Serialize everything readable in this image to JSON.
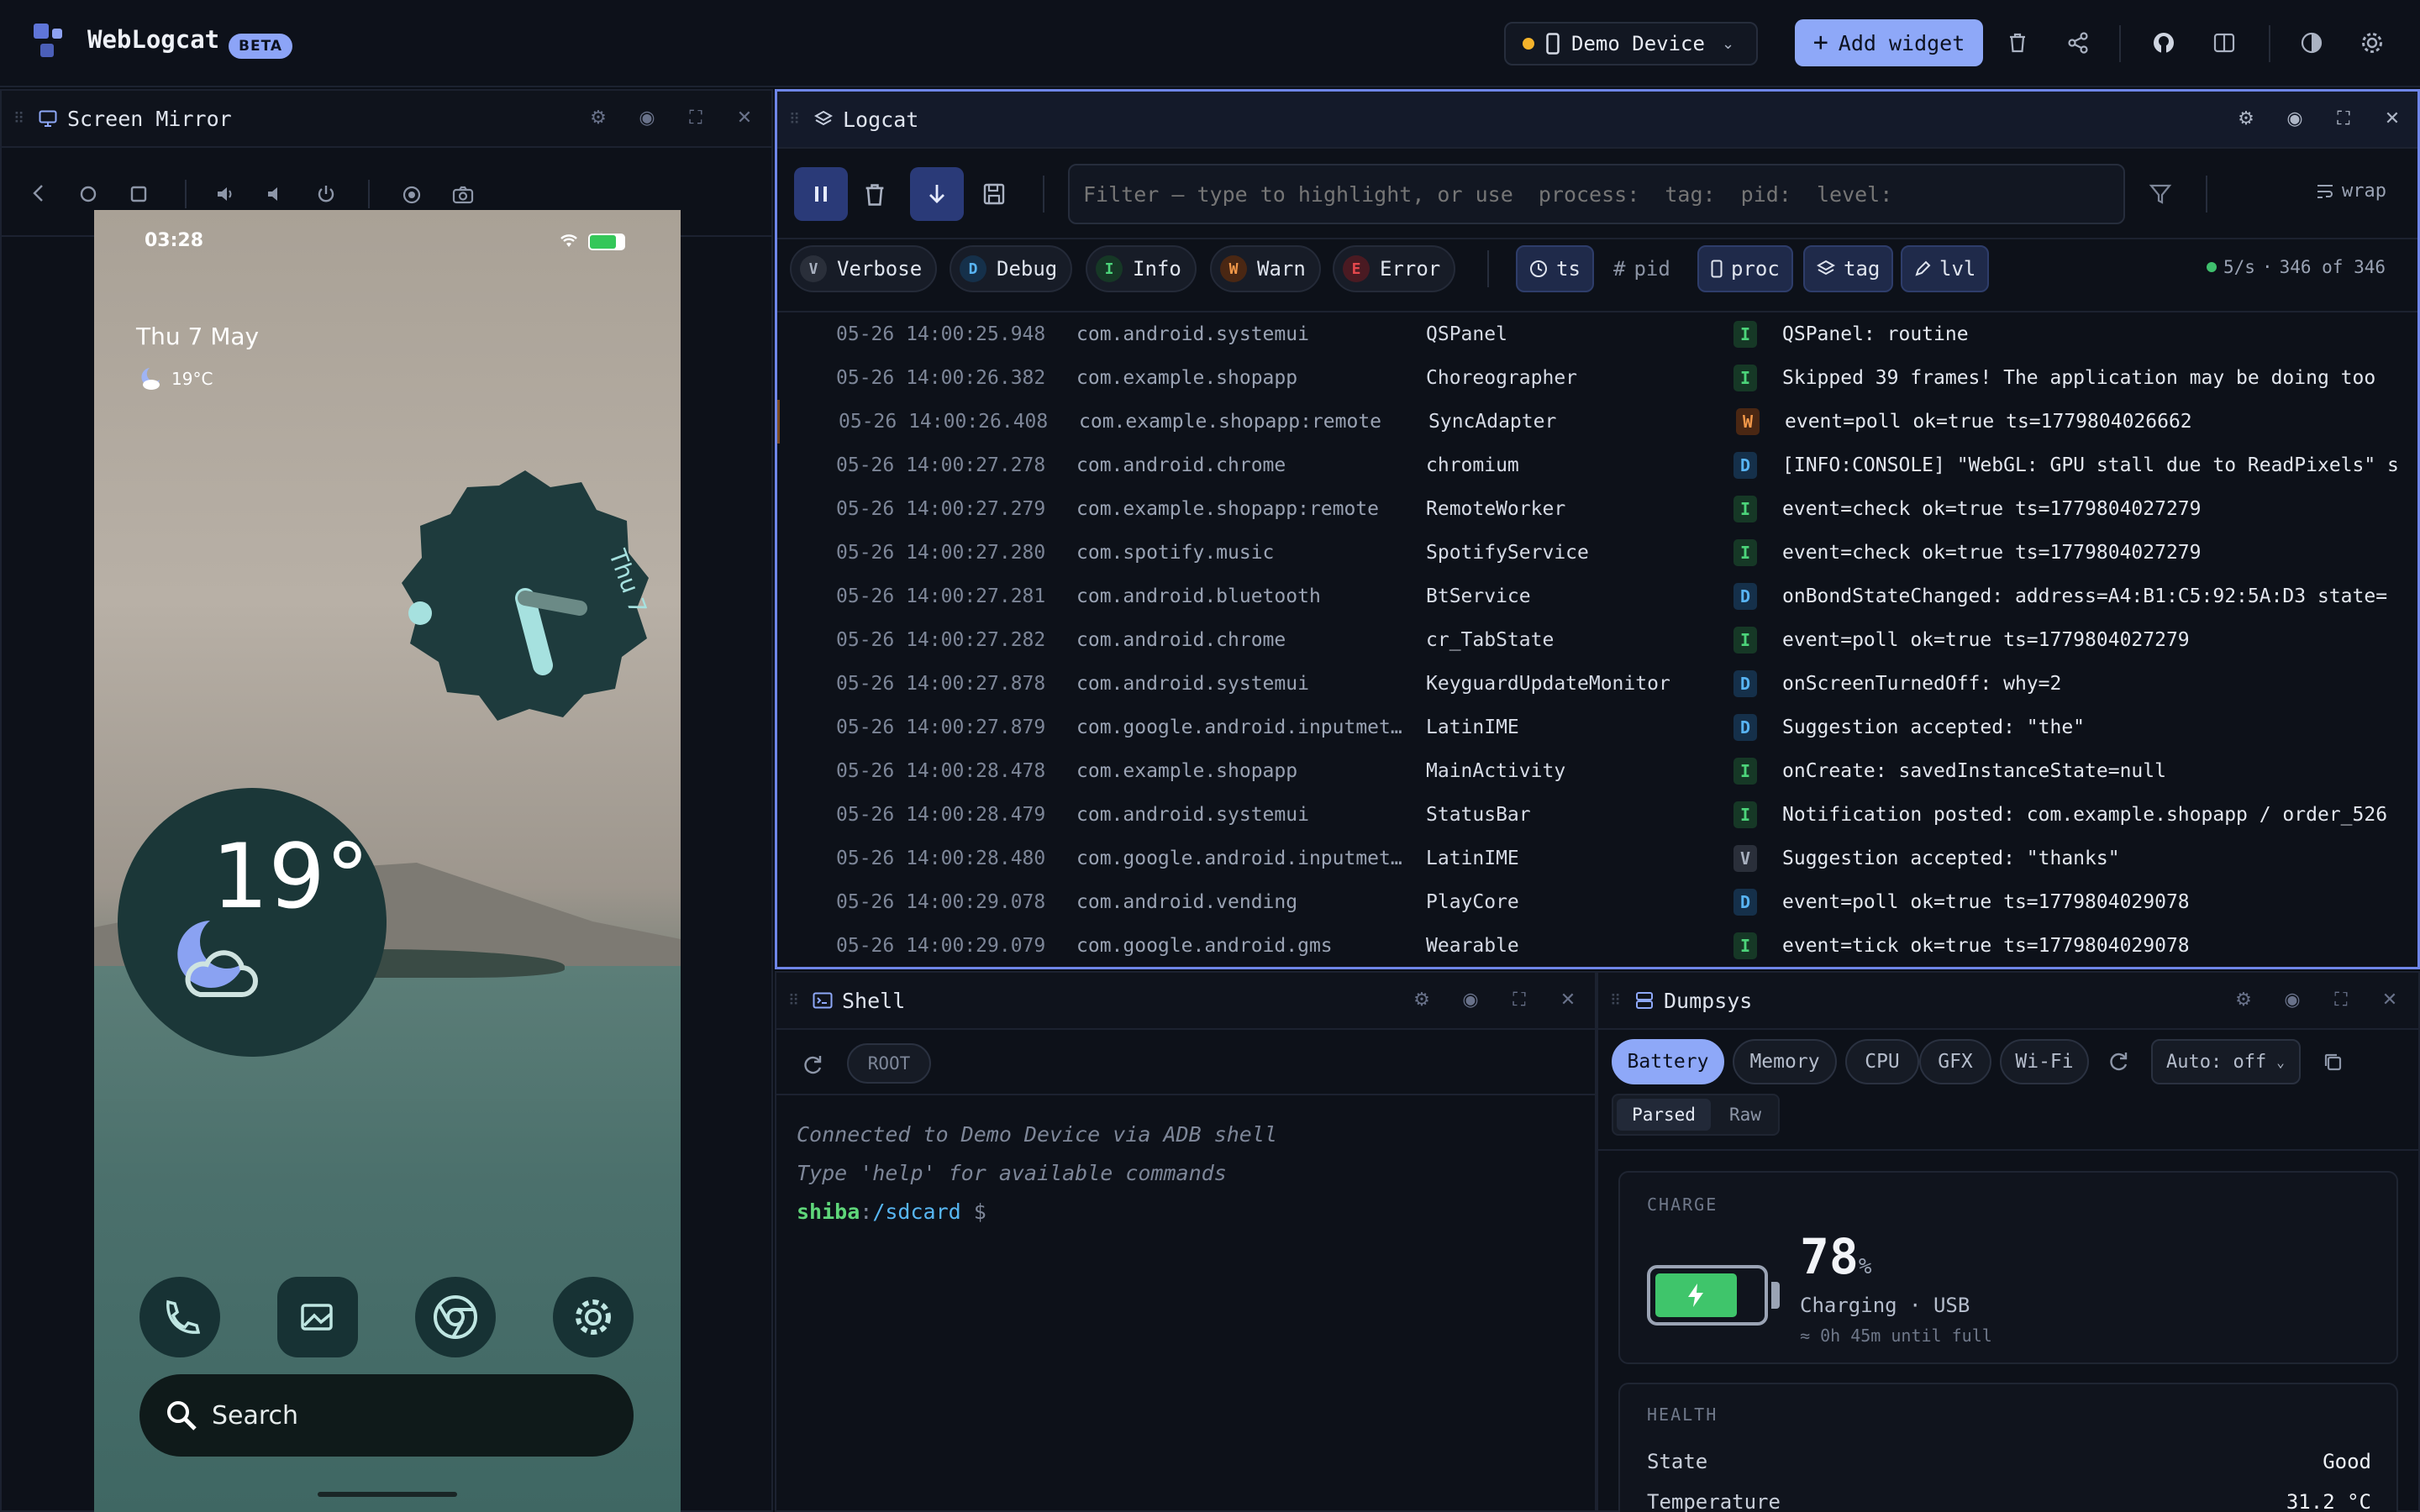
{
  "app": {
    "name": "WebLogcat",
    "badge": "BETA"
  },
  "topbar": {
    "device": "Demo Device",
    "add_widget": "Add widget"
  },
  "screen_mirror": {
    "title": "Screen Mirror",
    "phone": {
      "time": "03:28",
      "date": "Thu 7 May",
      "weather_small": "19°C",
      "clock_label": "Thu 7",
      "temp_big": "19°",
      "search": "Search"
    }
  },
  "logcat": {
    "title": "Logcat",
    "filter_placeholder": "Filter — type to highlight, or use  process:  tag:  pid:  level:",
    "wrap": "wrap",
    "levels": [
      {
        "letter": "V",
        "label": "Verbose"
      },
      {
        "letter": "D",
        "label": "Debug"
      },
      {
        "letter": "I",
        "label": "Info"
      },
      {
        "letter": "W",
        "label": "Warn"
      },
      {
        "letter": "E",
        "label": "Error"
      }
    ],
    "columns": {
      "ts": "ts",
      "pid": "pid",
      "proc": "proc",
      "tag": "tag",
      "lvl": "lvl"
    },
    "rate": "5/s",
    "count": "346 of 346",
    "rows": [
      {
        "ts": "05-26 14:00:25.948",
        "proc": "com.android.systemui",
        "tag": "QSPanel",
        "lvl": "I",
        "msg": "QSPanel: routine"
      },
      {
        "ts": "05-26 14:00:26.382",
        "proc": "com.example.shopapp",
        "tag": "Choreographer",
        "lvl": "I",
        "msg": "Skipped 39 frames!  The application may be doing too"
      },
      {
        "ts": "05-26 14:00:26.408",
        "proc": "com.example.shopapp:remote",
        "tag": "SyncAdapter",
        "lvl": "W",
        "msg": "event=poll ok=true ts=1779804026662"
      },
      {
        "ts": "05-26 14:00:27.278",
        "proc": "com.android.chrome",
        "tag": "chromium",
        "lvl": "D",
        "msg": "[INFO:CONSOLE] \"WebGL: GPU stall due to ReadPixels\" s"
      },
      {
        "ts": "05-26 14:00:27.279",
        "proc": "com.example.shopapp:remote",
        "tag": "RemoteWorker",
        "lvl": "I",
        "msg": "event=check ok=true ts=1779804027279"
      },
      {
        "ts": "05-26 14:00:27.280",
        "proc": "com.spotify.music",
        "tag": "SpotifyService",
        "lvl": "I",
        "msg": "event=check ok=true ts=1779804027279"
      },
      {
        "ts": "05-26 14:00:27.281",
        "proc": "com.android.bluetooth",
        "tag": "BtService",
        "lvl": "D",
        "msg": "onBondStateChanged: address=A4:B1:C5:92:5A:D3 state="
      },
      {
        "ts": "05-26 14:00:27.282",
        "proc": "com.android.chrome",
        "tag": "cr_TabState",
        "lvl": "I",
        "msg": "event=poll ok=true ts=1779804027279"
      },
      {
        "ts": "05-26 14:00:27.878",
        "proc": "com.android.systemui",
        "tag": "KeyguardUpdateMonitor",
        "lvl": "D",
        "msg": "onScreenTurnedOff: why=2"
      },
      {
        "ts": "05-26 14:00:27.879",
        "proc": "com.google.android.inputmet…",
        "tag": "LatinIME",
        "lvl": "D",
        "msg": "Suggestion accepted: \"the\""
      },
      {
        "ts": "05-26 14:00:28.478",
        "proc": "com.example.shopapp",
        "tag": "MainActivity",
        "lvl": "I",
        "msg": "onCreate: savedInstanceState=null"
      },
      {
        "ts": "05-26 14:00:28.479",
        "proc": "com.android.systemui",
        "tag": "StatusBar",
        "lvl": "I",
        "msg": "Notification posted: com.example.shopapp / order_526"
      },
      {
        "ts": "05-26 14:00:28.480",
        "proc": "com.google.android.inputmet…",
        "tag": "LatinIME",
        "lvl": "V",
        "msg": "Suggestion accepted: \"thanks\""
      },
      {
        "ts": "05-26 14:00:29.078",
        "proc": "com.android.vending",
        "tag": "PlayCore",
        "lvl": "D",
        "msg": "event=poll ok=true ts=1779804029078"
      },
      {
        "ts": "05-26 14:00:29.079",
        "proc": "com.google.android.gms",
        "tag": "Wearable",
        "lvl": "I",
        "msg": "event=tick ok=true ts=1779804029078"
      }
    ]
  },
  "shell": {
    "title": "Shell",
    "root": "ROOT",
    "line1": "Connected to Demo Device via ADB shell",
    "line2": "Type 'help' for available commands",
    "prompt_user": "shiba",
    "prompt_colon": ":",
    "prompt_path": "/sdcard",
    "prompt_sign": "$"
  },
  "dumpsys": {
    "title": "Dumpsys",
    "tabs": [
      "Battery",
      "Memory",
      "CPU",
      "GFX",
      "Wi-Fi"
    ],
    "auto": "Auto: off",
    "views": [
      "Parsed",
      "Raw"
    ],
    "charge_label": "CHARGE",
    "charge_value": "78",
    "charge_unit": "%",
    "charge_level": 0.78,
    "charging": "Charging · USB",
    "until_full": "≈ 0h 45m until full",
    "health_label": "HEALTH",
    "health_rows": [
      {
        "k": "State",
        "v": "Good"
      },
      {
        "k": "Temperature",
        "v": "31.2 °C"
      }
    ]
  },
  "colors": {
    "accent": "#8ea8f8",
    "info": "#4cd47a",
    "debug": "#58b4f4",
    "warn": "#f39849",
    "error": "#e5484d",
    "verbose": "#a8b0bf"
  }
}
